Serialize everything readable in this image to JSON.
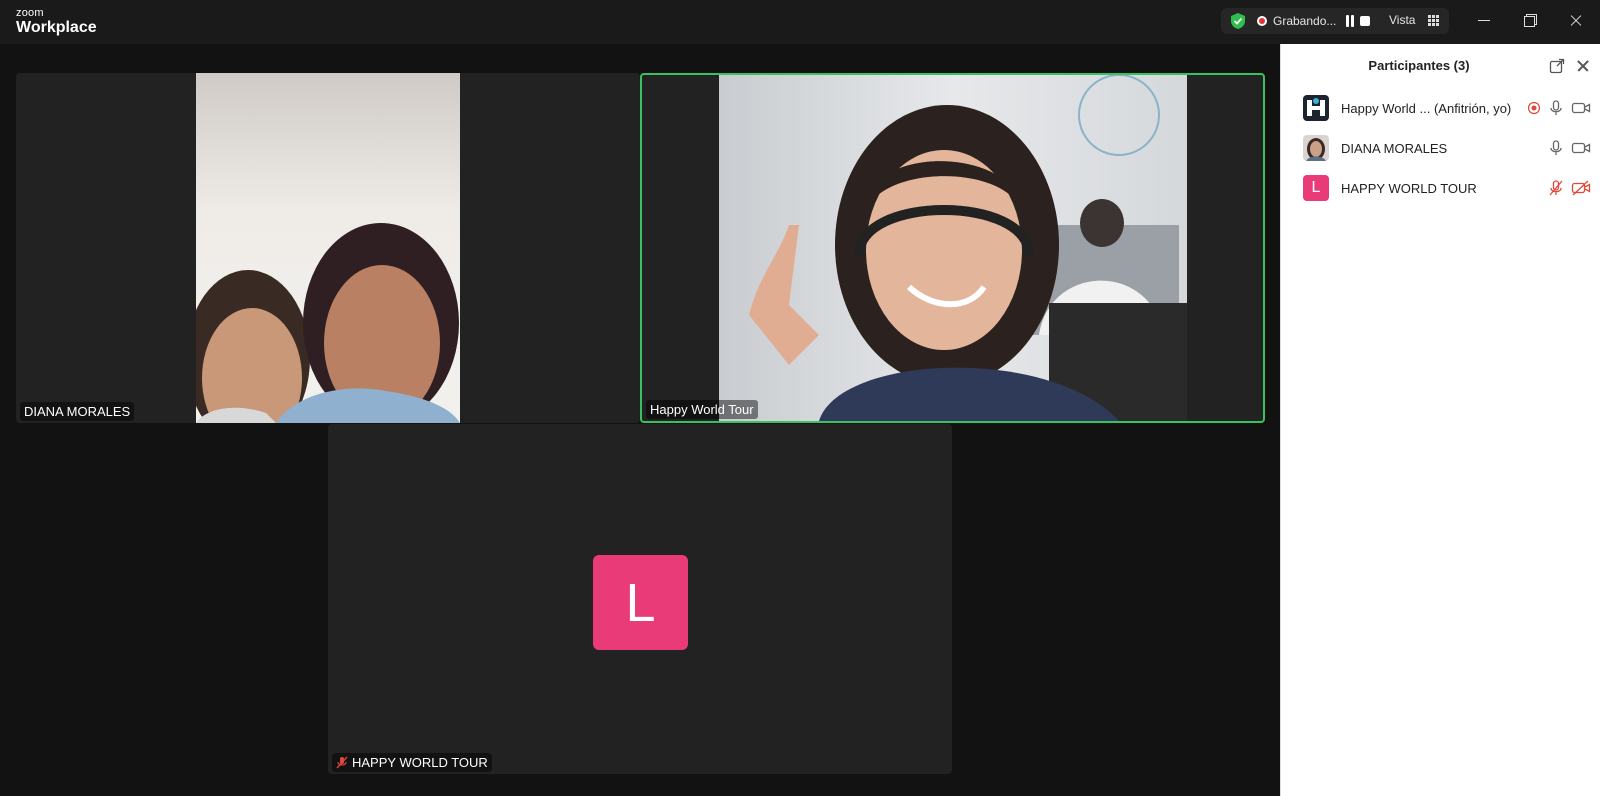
{
  "app": {
    "logo_small": "zoom",
    "logo_big": "Workplace"
  },
  "recording": {
    "status_text": "Grabando...",
    "view_label": "Vista"
  },
  "tiles": [
    {
      "name": "DIANA MORALES"
    },
    {
      "name": "Happy World Tour"
    },
    {
      "name": "HAPPY WORLD TOUR",
      "avatar_letter": "L",
      "avatar_color": "#e83b77"
    }
  ],
  "participants_panel": {
    "title": "Participantes (3)",
    "items": [
      {
        "name": "Happy World ...  (Anfitrión, yo)"
      },
      {
        "name": "DIANA MORALES"
      },
      {
        "name": "HAPPY WORLD TOUR",
        "avatar_letter": "L"
      }
    ]
  },
  "colors": {
    "active_speaker_border": "#37c25f",
    "recording_red": "#e03434",
    "avatar_pink": "#e83b77",
    "muted_red": "#e0483c"
  }
}
